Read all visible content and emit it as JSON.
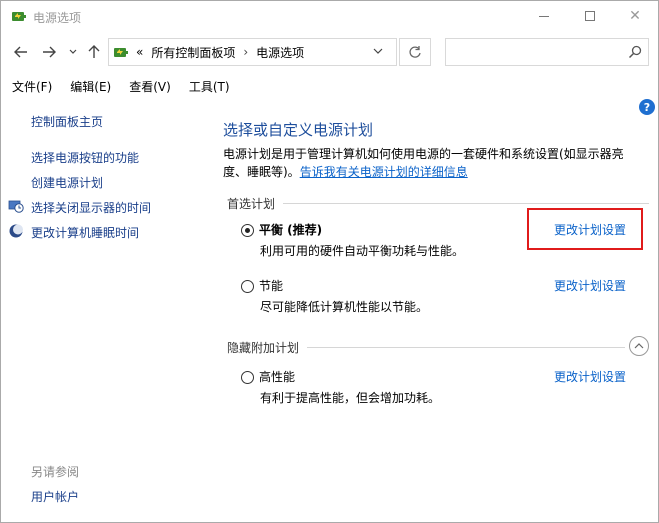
{
  "window": {
    "title": "电源选项"
  },
  "nav": {
    "back_icon": "arrow-left-icon",
    "forward_icon": "arrow-right-icon",
    "recent_icon": "chevron-down-icon",
    "up_icon": "arrow-up-icon",
    "overflow": "«",
    "breadcrumbs": [
      "所有控制面板项",
      "电源选项"
    ],
    "refresh_icon": "refresh-icon",
    "search_placeholder": ""
  },
  "menu": {
    "items": [
      "文件(F)",
      "编辑(E)",
      "查看(V)",
      "工具(T)"
    ]
  },
  "sidebar": {
    "home": "控制面板主页",
    "items": [
      "选择电源按钮的功能",
      "创建电源计划",
      "选择关闭显示器的时间",
      "更改计算机睡眠时间"
    ],
    "see_also_heading": "另请参阅",
    "see_also_items": [
      "用户帐户"
    ]
  },
  "main": {
    "title": "选择或自定义电源计划",
    "description": "电源计划是用于管理计算机如何使用电源的一套硬件和系统设置(如显示器亮度、睡眠等)。",
    "description_link": "告诉我有关电源计划的详细信息",
    "preferred_heading": "首选计划",
    "hidden_heading": "隐藏附加计划",
    "plans": [
      {
        "name": "平衡 (推荐)",
        "desc": "利用可用的硬件自动平衡功耗与性能。",
        "link": "更改计划设置",
        "selected": true
      },
      {
        "name": "节能",
        "desc": "尽可能降低计算机性能以节能。",
        "link": "更改计划设置",
        "selected": false
      },
      {
        "name": "高性能",
        "desc": "有利于提高性能，但会增加功耗。",
        "link": "更改计划设置",
        "selected": false
      }
    ]
  },
  "colors": {
    "accent_link": "#0a62c9",
    "title_blue": "#1e4e9c",
    "highlight_red": "#e01b1b"
  }
}
